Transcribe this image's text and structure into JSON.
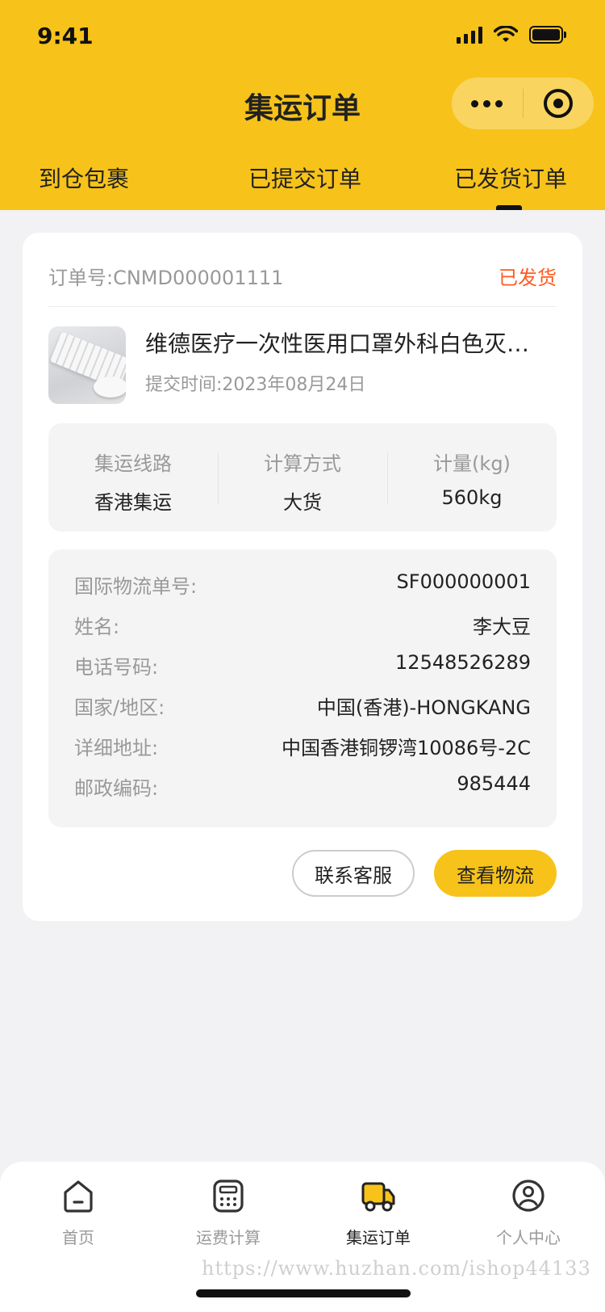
{
  "status_bar": {
    "time": "9:41"
  },
  "nav": {
    "title": "集运订单"
  },
  "tabs": [
    {
      "label": "到仓包裹"
    },
    {
      "label": "已提交订单"
    },
    {
      "label": "已发货订单",
      "active": true
    }
  ],
  "order": {
    "number_label": "订单号:CNMD000001111",
    "status": "已发货",
    "product_name": "维德医疗一次性医用口罩外科白色灭菌...",
    "submit_time": "提交时间:2023年08月24日",
    "stats": [
      {
        "label": "集运线路",
        "value": "香港集运"
      },
      {
        "label": "计算方式",
        "value": "大货"
      },
      {
        "label": "计量(kg)",
        "value": "560kg"
      }
    ],
    "info": [
      {
        "label": "国际物流单号:",
        "value": "SF000000001"
      },
      {
        "label": "姓名:",
        "value": "李大豆"
      },
      {
        "label": "电话号码:",
        "value": "12548526289"
      },
      {
        "label": "国家/地区:",
        "value": "中国(香港)-HONGKANG"
      },
      {
        "label": "详细地址:",
        "value": "中国香港铜锣湾10086号-2C"
      },
      {
        "label": "邮政编码:",
        "value": "985444"
      }
    ],
    "actions": {
      "service_label": "联系客服",
      "track_label": "查看物流"
    }
  },
  "tabbar": [
    {
      "label": "首页",
      "icon": "home-icon"
    },
    {
      "label": "运费计算",
      "icon": "calculator-icon"
    },
    {
      "label": "集运订单",
      "icon": "truck-icon",
      "active": true
    },
    {
      "label": "个人中心",
      "icon": "user-icon"
    }
  ],
  "watermark": "https://www.huzhan.com/ishop44133",
  "colors": {
    "brand": "#f7c31a",
    "status": "#ff5a1f",
    "background": "#f2f2f4"
  }
}
